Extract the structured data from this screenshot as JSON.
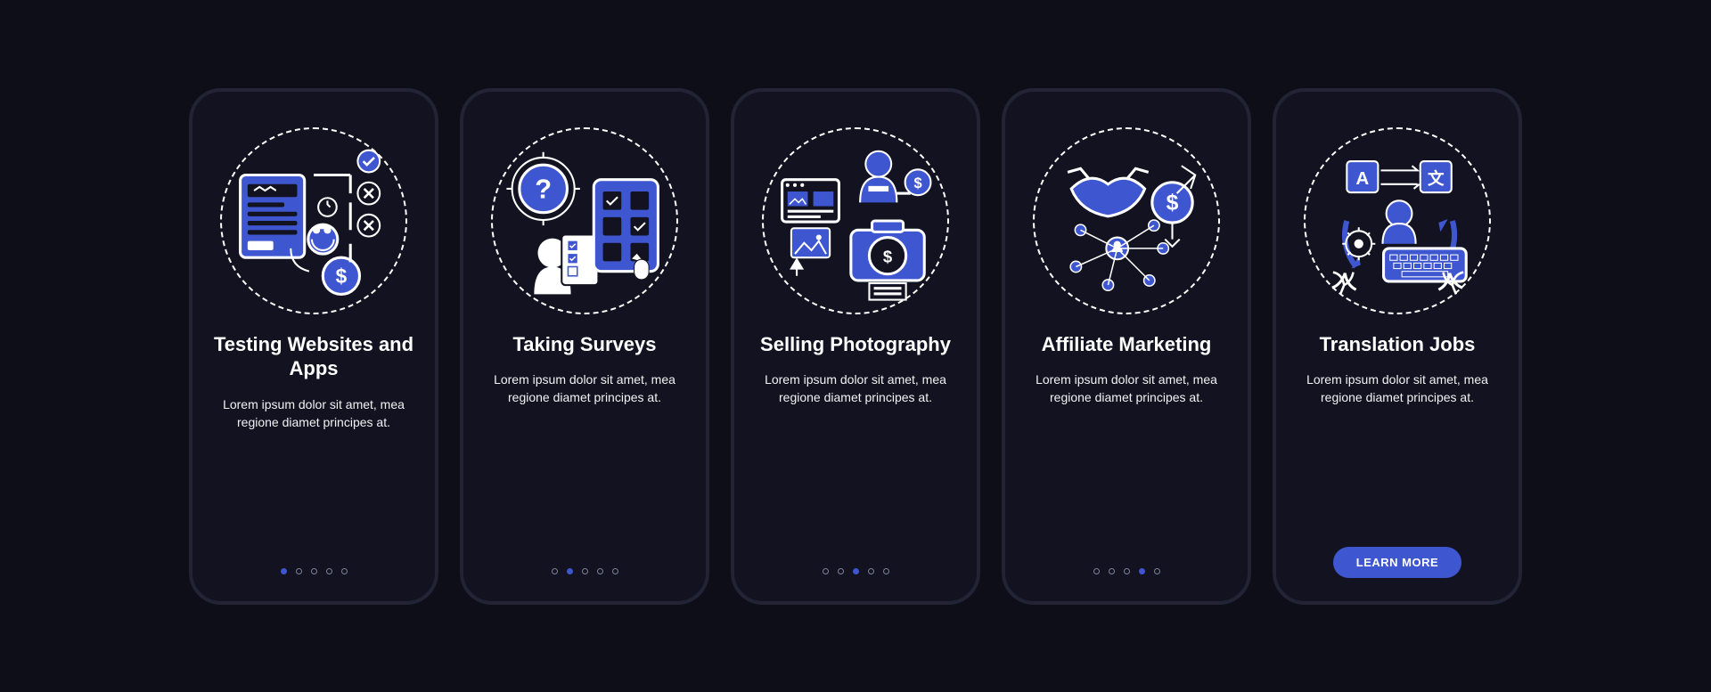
{
  "screens": [
    {
      "title": "Testing Websites and Apps",
      "description": "Lorem ipsum dolor sit amet, mea regione diamet principes at.",
      "icon_name": "testing-apps-icon",
      "active_dot": 0,
      "show_cta": false
    },
    {
      "title": "Taking Surveys",
      "description": "Lorem ipsum dolor sit amet, mea regione diamet principes at.",
      "icon_name": "surveys-icon",
      "active_dot": 1,
      "show_cta": false
    },
    {
      "title": "Selling Photography",
      "description": "Lorem ipsum dolor sit amet, mea regione diamet principes at.",
      "icon_name": "photography-icon",
      "active_dot": 2,
      "show_cta": false
    },
    {
      "title": "Affiliate Marketing",
      "description": "Lorem ipsum dolor sit amet, mea regione diamet principes at.",
      "icon_name": "affiliate-icon",
      "active_dot": 3,
      "show_cta": false
    },
    {
      "title": "Translation Jobs",
      "description": "Lorem ipsum dolor sit amet, mea regione diamet principes at.",
      "icon_name": "translation-icon",
      "active_dot": 4,
      "show_cta": true
    }
  ],
  "cta_label": "LEARN MORE",
  "colors": {
    "accent": "#3f56d1",
    "background": "#121220",
    "frame": "#222436"
  },
  "dot_count": 5
}
